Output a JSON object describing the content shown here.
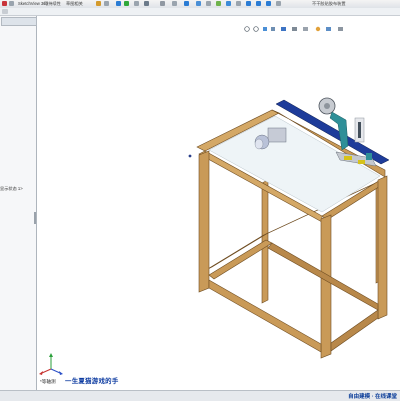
{
  "app": {
    "tabs": [
      "SketchView 360",
      "可持续性",
      "草图相关",
      "MBD"
    ],
    "window_title": "不干胶贴胶布装置"
  },
  "left_panel": {
    "material_label": "显示状态 1>",
    "tab_icon": "feature-tree-icon"
  },
  "viewport": {
    "view_label": "*等轴测",
    "watermark": "一生夏猫游戏的手"
  },
  "statusbar": {
    "right_text": "自由建模 · 在线课堂"
  },
  "colors": {
    "frame": "#c99a58",
    "frame_dark": "#8f6631",
    "rail": "#1e3c9a",
    "accent_teal": "#2e8f98",
    "motor": "#b9c2d8",
    "yellow": "#d6c21a"
  }
}
